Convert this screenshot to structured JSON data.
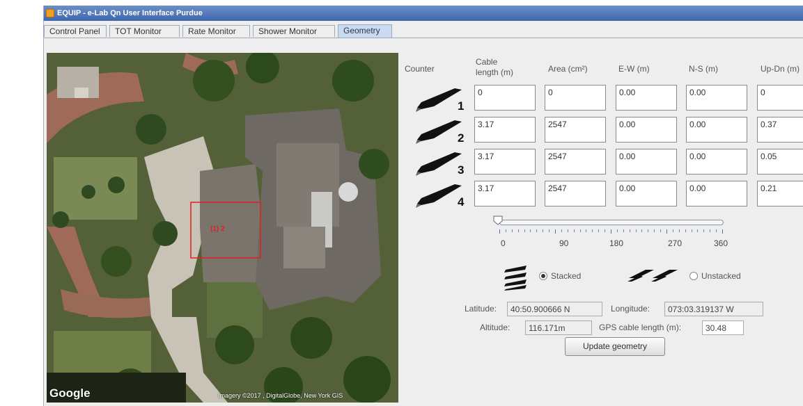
{
  "window": {
    "title": "EQUIP - e-Lab Qn User Interface Purdue"
  },
  "tabs": [
    {
      "label": "Control Panel"
    },
    {
      "label": "TOT Monitor"
    },
    {
      "label": "Rate Monitor"
    },
    {
      "label": "Shower Monitor"
    },
    {
      "label": "Geometry"
    }
  ],
  "active_tab": "Geometry",
  "map": {
    "logo": "Google",
    "credit": "Imagery ©2017 , DigitalGlobe, New York GIS",
    "marker_label": "(1) 2"
  },
  "table": {
    "headers": {
      "counter": "Counter",
      "cable_line1": "Cable",
      "cable_line2": "length (m)",
      "area": "Area (cm²)",
      "ew": "E-W (m)",
      "ns": "N-S (m)",
      "updn": "Up-Dn (m)"
    },
    "rows": [
      {
        "counter": "1",
        "cable": "0",
        "area": "0",
        "ew": "0.00",
        "ns": "0.00",
        "updn": "0"
      },
      {
        "counter": "2",
        "cable": "3.17",
        "area": "2547",
        "ew": "0.00",
        "ns": "0.00",
        "updn": "0.37"
      },
      {
        "counter": "3",
        "cable": "3.17",
        "area": "2547",
        "ew": "0.00",
        "ns": "0.00",
        "updn": "0.05"
      },
      {
        "counter": "4",
        "cable": "3.17",
        "area": "2547",
        "ew": "0.00",
        "ns": "0.00",
        "updn": "0.21"
      }
    ]
  },
  "orientation_slider": {
    "value": 0,
    "min": 0,
    "max": 360,
    "labels": [
      "0",
      "90",
      "180",
      "270",
      "360"
    ]
  },
  "stacking": {
    "stacked_label": "Stacked",
    "unstacked_label": "Unstacked",
    "selected": "Stacked"
  },
  "location": {
    "latitude_label": "Latitude:",
    "latitude": "40:50.900666 N",
    "longitude_label": "Longitude:",
    "longitude": "073:03.319137 W",
    "altitude_label": "Altitude:",
    "altitude": "116.171m",
    "gps_cable_label": "GPS cable length (m):",
    "gps_cable": "30.48"
  },
  "update_button": "Update geometry",
  "colors": {
    "title_bar": "#3e66ad",
    "active_tab": "#c8dbf2",
    "marker": "#e02020"
  },
  "icons": {
    "counter": "paddle-counter-icon",
    "stacked": "stacked-counters-icon",
    "unstacked": "unstacked-counters-icon"
  }
}
